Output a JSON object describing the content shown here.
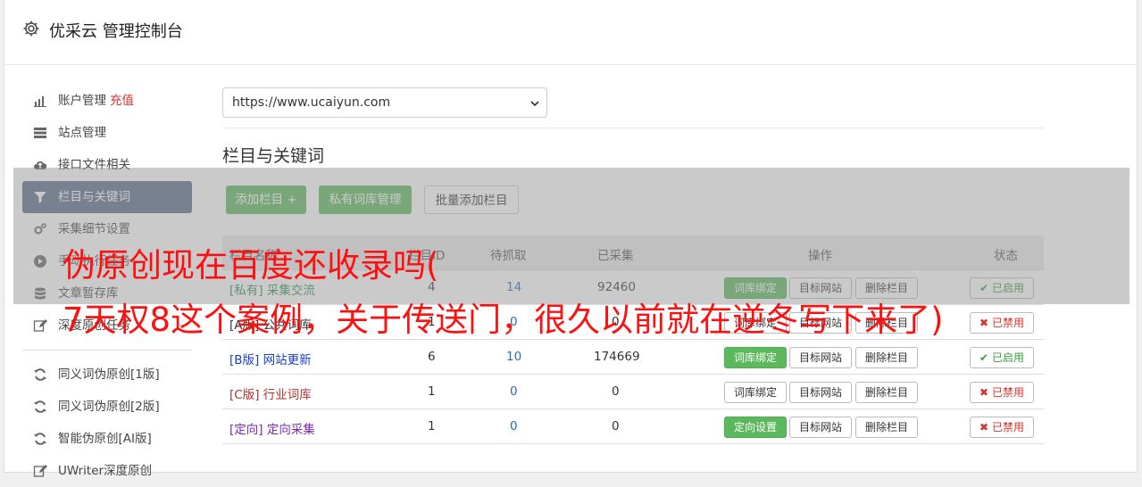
{
  "header": {
    "title": "优采云 管理控制台"
  },
  "sidebar": {
    "items": [
      {
        "label": "账户管理",
        "extra": "充值",
        "icon": "bar-chart-icon"
      },
      {
        "label": "站点管理",
        "icon": "server-icon"
      },
      {
        "label": "接口文件相关",
        "icon": "cloud-upload-icon"
      },
      {
        "label": "栏目与关键词",
        "icon": "filter-icon",
        "active": true
      },
      {
        "label": "采集细节设置",
        "icon": "gears-icon"
      },
      {
        "label": "手动执行任务",
        "icon": "play-icon"
      },
      {
        "label": "文章暂存库",
        "icon": "database-icon"
      },
      {
        "label": "深度原创任务",
        "icon": "edit-icon"
      }
    ],
    "items2": [
      {
        "label": "同义词伪原创[1版]",
        "icon": "refresh-icon"
      },
      {
        "label": "同义词伪原创[2版]",
        "icon": "refresh-icon"
      },
      {
        "label": "智能伪原创[AI版]",
        "icon": "refresh-icon"
      },
      {
        "label": "UWriter深度原创",
        "icon": "edit-icon"
      }
    ]
  },
  "main": {
    "site_select": "https://www.ucaiyun.com",
    "section_title": "栏目与关键词",
    "buttons": {
      "add_column": "添加栏目 +",
      "private_lib": "私有词库管理",
      "batch_add": "批量添加栏目"
    },
    "table": {
      "headers": [
        "栏目名称",
        "栏目ID",
        "待抓取",
        "已采集",
        "操作",
        "状态"
      ],
      "rows": [
        {
          "tag": "[私有]",
          "name": "采集交流",
          "id": "4",
          "pending": "14",
          "collected": "92460",
          "op1": "词库绑定",
          "op1_green": true,
          "op2": "目标网站",
          "op3": "删除栏目",
          "status": "已启用",
          "status_on": true,
          "tagclass": "tag-private"
        },
        {
          "tag": "[A版]",
          "name": "公共词库",
          "id": "1",
          "pending": "0",
          "collected": "0",
          "op1": "词库绑定",
          "op1_green": false,
          "op2": "目标网站",
          "op3": "删除栏目",
          "status": "已禁用",
          "status_on": false,
          "tagclass": "tag-a"
        },
        {
          "tag": "[B版]",
          "name": "网站更新",
          "id": "6",
          "pending": "10",
          "collected": "174669",
          "op1": "词库绑定",
          "op1_green": true,
          "op2": "目标网站",
          "op3": "删除栏目",
          "status": "已启用",
          "status_on": true,
          "tagclass": "tag-b"
        },
        {
          "tag": "[C版]",
          "name": "行业词库",
          "id": "1",
          "pending": "0",
          "collected": "0",
          "op1": "词库绑定",
          "op1_green": false,
          "op2": "目标网站",
          "op3": "删除栏目",
          "status": "已禁用",
          "status_on": false,
          "tagclass": "tag-c"
        },
        {
          "tag": "[定向]",
          "name": "定向采集",
          "id": "1",
          "pending": "0",
          "collected": "0",
          "op1": "定向设置",
          "op1_green": true,
          "op2": "目标网站",
          "op3": "删除栏目",
          "status": "已禁用",
          "status_on": false,
          "tagclass": "tag-d"
        }
      ]
    }
  },
  "overlay": {
    "line1": "伪原创现在百度还收录吗(",
    "line2": "7天权8这个案例，关于传送门，很久以前就在逆冬写下来了)"
  },
  "colors": {
    "active_nav": "#5a6c8a",
    "green": "#5cb85c",
    "overlay_text": "#ff1010"
  }
}
